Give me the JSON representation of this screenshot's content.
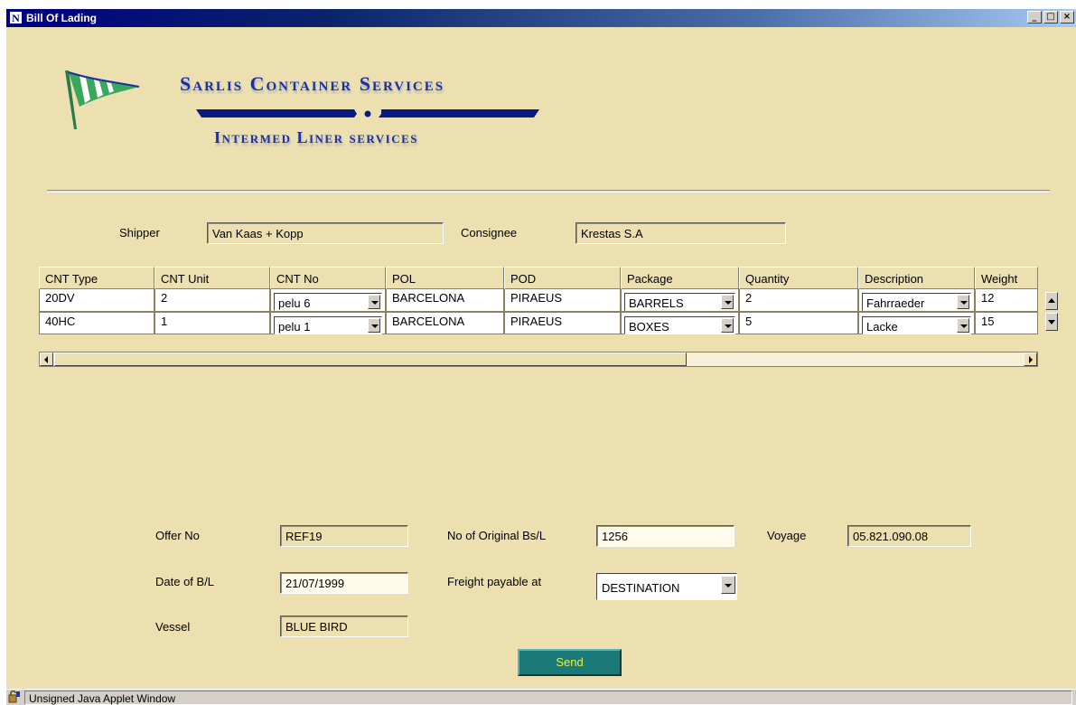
{
  "window": {
    "title": "Bill Of Lading",
    "app_letter": "N",
    "controls": {
      "minimize": "_",
      "maximize": "□",
      "close": "×"
    }
  },
  "branding": {
    "company": "Sarlis Container Services",
    "division": "Intermed Liner services"
  },
  "parties": {
    "shipper_label": "Shipper",
    "shipper_value": "Van Kaas + Kopp",
    "consignee_label": "Consignee",
    "consignee_value": "Krestas S.A"
  },
  "table": {
    "columns": [
      "CNT Type",
      "CNT Unit",
      "CNT No",
      "POL",
      "POD",
      "Package",
      "Quantity",
      "Description",
      "Weight"
    ],
    "rows": [
      {
        "cnt_type": "20DV",
        "cnt_unit": "2",
        "cnt_no": "pelu 6",
        "pol": "BARCELONA",
        "pod": "PIRAEUS",
        "package": "BARRELS",
        "quantity": "2",
        "description": "Fahrraeder",
        "weight": "12"
      },
      {
        "cnt_type": "40HC",
        "cnt_unit": "1",
        "cnt_no": "pelu 1",
        "pol": "BARCELONA",
        "pod": "PIRAEUS",
        "package": "BOXES",
        "quantity": "5",
        "description": "Lacke",
        "weight": "15"
      }
    ]
  },
  "form": {
    "offer_no_label": "Offer No",
    "offer_no": "REF19",
    "originals_label": "No of Original Bs/L",
    "originals": "1256",
    "voyage_label": "Voyage",
    "voyage": "05.821.090.08",
    "date_label": "Date of B/L",
    "date": "21/07/1999",
    "freight_label": "Freight payable at",
    "freight": "DESTINATION",
    "vessel_label": "Vessel",
    "vessel": "BLUE BIRD"
  },
  "send_label": "Send",
  "status": "Unsigned Java Applet Window",
  "colors": {
    "background": "#ece0b0",
    "titlebar": "#000080",
    "send_button": "#1a7a7a",
    "send_text": "#e8f040",
    "brand_text": "#1b2fa0"
  }
}
